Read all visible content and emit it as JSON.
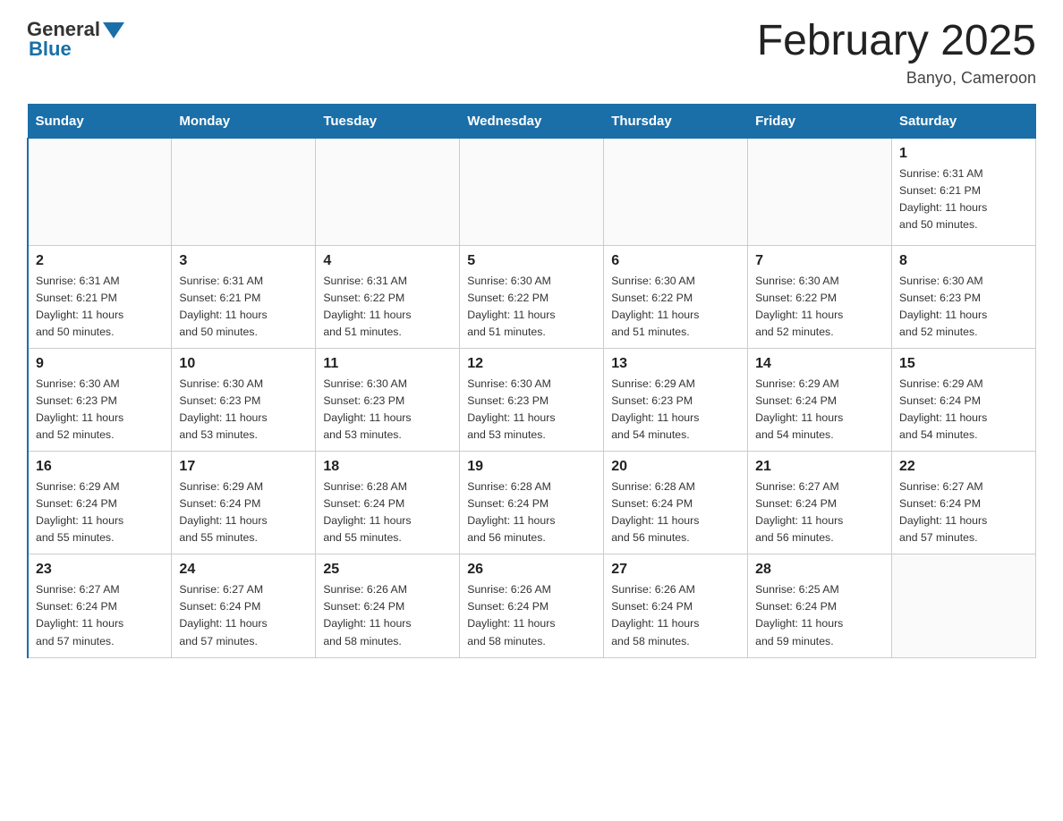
{
  "header": {
    "logo_general": "General",
    "logo_blue": "Blue",
    "title": "February 2025",
    "subtitle": "Banyo, Cameroon"
  },
  "days_of_week": [
    "Sunday",
    "Monday",
    "Tuesday",
    "Wednesday",
    "Thursday",
    "Friday",
    "Saturday"
  ],
  "weeks": [
    {
      "days": [
        {
          "number": "",
          "info": ""
        },
        {
          "number": "",
          "info": ""
        },
        {
          "number": "",
          "info": ""
        },
        {
          "number": "",
          "info": ""
        },
        {
          "number": "",
          "info": ""
        },
        {
          "number": "",
          "info": ""
        },
        {
          "number": "1",
          "info": "Sunrise: 6:31 AM\nSunset: 6:21 PM\nDaylight: 11 hours\nand 50 minutes."
        }
      ]
    },
    {
      "days": [
        {
          "number": "2",
          "info": "Sunrise: 6:31 AM\nSunset: 6:21 PM\nDaylight: 11 hours\nand 50 minutes."
        },
        {
          "number": "3",
          "info": "Sunrise: 6:31 AM\nSunset: 6:21 PM\nDaylight: 11 hours\nand 50 minutes."
        },
        {
          "number": "4",
          "info": "Sunrise: 6:31 AM\nSunset: 6:22 PM\nDaylight: 11 hours\nand 51 minutes."
        },
        {
          "number": "5",
          "info": "Sunrise: 6:30 AM\nSunset: 6:22 PM\nDaylight: 11 hours\nand 51 minutes."
        },
        {
          "number": "6",
          "info": "Sunrise: 6:30 AM\nSunset: 6:22 PM\nDaylight: 11 hours\nand 51 minutes."
        },
        {
          "number": "7",
          "info": "Sunrise: 6:30 AM\nSunset: 6:22 PM\nDaylight: 11 hours\nand 52 minutes."
        },
        {
          "number": "8",
          "info": "Sunrise: 6:30 AM\nSunset: 6:23 PM\nDaylight: 11 hours\nand 52 minutes."
        }
      ]
    },
    {
      "days": [
        {
          "number": "9",
          "info": "Sunrise: 6:30 AM\nSunset: 6:23 PM\nDaylight: 11 hours\nand 52 minutes."
        },
        {
          "number": "10",
          "info": "Sunrise: 6:30 AM\nSunset: 6:23 PM\nDaylight: 11 hours\nand 53 minutes."
        },
        {
          "number": "11",
          "info": "Sunrise: 6:30 AM\nSunset: 6:23 PM\nDaylight: 11 hours\nand 53 minutes."
        },
        {
          "number": "12",
          "info": "Sunrise: 6:30 AM\nSunset: 6:23 PM\nDaylight: 11 hours\nand 53 minutes."
        },
        {
          "number": "13",
          "info": "Sunrise: 6:29 AM\nSunset: 6:23 PM\nDaylight: 11 hours\nand 54 minutes."
        },
        {
          "number": "14",
          "info": "Sunrise: 6:29 AM\nSunset: 6:24 PM\nDaylight: 11 hours\nand 54 minutes."
        },
        {
          "number": "15",
          "info": "Sunrise: 6:29 AM\nSunset: 6:24 PM\nDaylight: 11 hours\nand 54 minutes."
        }
      ]
    },
    {
      "days": [
        {
          "number": "16",
          "info": "Sunrise: 6:29 AM\nSunset: 6:24 PM\nDaylight: 11 hours\nand 55 minutes."
        },
        {
          "number": "17",
          "info": "Sunrise: 6:29 AM\nSunset: 6:24 PM\nDaylight: 11 hours\nand 55 minutes."
        },
        {
          "number": "18",
          "info": "Sunrise: 6:28 AM\nSunset: 6:24 PM\nDaylight: 11 hours\nand 55 minutes."
        },
        {
          "number": "19",
          "info": "Sunrise: 6:28 AM\nSunset: 6:24 PM\nDaylight: 11 hours\nand 56 minutes."
        },
        {
          "number": "20",
          "info": "Sunrise: 6:28 AM\nSunset: 6:24 PM\nDaylight: 11 hours\nand 56 minutes."
        },
        {
          "number": "21",
          "info": "Sunrise: 6:27 AM\nSunset: 6:24 PM\nDaylight: 11 hours\nand 56 minutes."
        },
        {
          "number": "22",
          "info": "Sunrise: 6:27 AM\nSunset: 6:24 PM\nDaylight: 11 hours\nand 57 minutes."
        }
      ]
    },
    {
      "days": [
        {
          "number": "23",
          "info": "Sunrise: 6:27 AM\nSunset: 6:24 PM\nDaylight: 11 hours\nand 57 minutes."
        },
        {
          "number": "24",
          "info": "Sunrise: 6:27 AM\nSunset: 6:24 PM\nDaylight: 11 hours\nand 57 minutes."
        },
        {
          "number": "25",
          "info": "Sunrise: 6:26 AM\nSunset: 6:24 PM\nDaylight: 11 hours\nand 58 minutes."
        },
        {
          "number": "26",
          "info": "Sunrise: 6:26 AM\nSunset: 6:24 PM\nDaylight: 11 hours\nand 58 minutes."
        },
        {
          "number": "27",
          "info": "Sunrise: 6:26 AM\nSunset: 6:24 PM\nDaylight: 11 hours\nand 58 minutes."
        },
        {
          "number": "28",
          "info": "Sunrise: 6:25 AM\nSunset: 6:24 PM\nDaylight: 11 hours\nand 59 minutes."
        },
        {
          "number": "",
          "info": ""
        }
      ]
    }
  ]
}
